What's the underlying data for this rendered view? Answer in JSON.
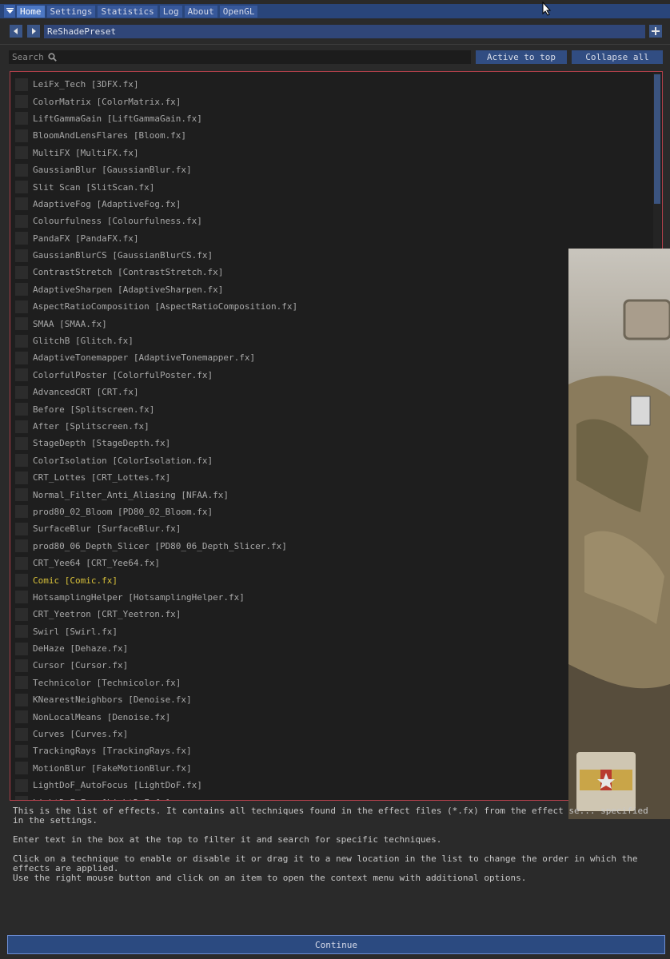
{
  "tabs": [
    "Home",
    "Settings",
    "Statistics",
    "Log",
    "About",
    "OpenGL"
  ],
  "preset": {
    "name": "ReShadePreset",
    "prev_icon": "triangle-left-icon",
    "next_icon": "triangle-right-icon",
    "add_icon": "plus-icon"
  },
  "search": {
    "placeholder": "Search"
  },
  "buttons": {
    "active_to_top": "Active to top",
    "collapse_all": "Collapse all",
    "continue": "Continue"
  },
  "effects": [
    {
      "label": "LeiFx_Tech [3DFX.fx]",
      "enabled": false
    },
    {
      "label": "ColorMatrix [ColorMatrix.fx]",
      "enabled": false
    },
    {
      "label": "LiftGammaGain [LiftGammaGain.fx]",
      "enabled": false
    },
    {
      "label": "BloomAndLensFlares [Bloom.fx]",
      "enabled": false
    },
    {
      "label": "MultiFX [MultiFX.fx]",
      "enabled": false
    },
    {
      "label": "GaussianBlur [GaussianBlur.fx]",
      "enabled": false
    },
    {
      "label": "Slit Scan [SlitScan.fx]",
      "enabled": false
    },
    {
      "label": "AdaptiveFog [AdaptiveFog.fx]",
      "enabled": false
    },
    {
      "label": "Colourfulness [Colourfulness.fx]",
      "enabled": false
    },
    {
      "label": "PandaFX [PandaFX.fx]",
      "enabled": false
    },
    {
      "label": "GaussianBlurCS [GaussianBlurCS.fx]",
      "enabled": false
    },
    {
      "label": "ContrastStretch [ContrastStretch.fx]",
      "enabled": false
    },
    {
      "label": "AdaptiveSharpen [AdaptiveSharpen.fx]",
      "enabled": false
    },
    {
      "label": "AspectRatioComposition [AspectRatioComposition.fx]",
      "enabled": false
    },
    {
      "label": "SMAA [SMAA.fx]",
      "enabled": false
    },
    {
      "label": "GlitchB [Glitch.fx]",
      "enabled": false
    },
    {
      "label": "AdaptiveTonemapper [AdaptiveTonemapper.fx]",
      "enabled": false
    },
    {
      "label": "ColorfulPoster [ColorfulPoster.fx]",
      "enabled": false
    },
    {
      "label": "AdvancedCRT [CRT.fx]",
      "enabled": false
    },
    {
      "label": "Before [Splitscreen.fx]",
      "enabled": false
    },
    {
      "label": "After [Splitscreen.fx]",
      "enabled": false
    },
    {
      "label": "StageDepth [StageDepth.fx]",
      "enabled": false
    },
    {
      "label": "ColorIsolation [ColorIsolation.fx]",
      "enabled": false
    },
    {
      "label": "CRT_Lottes [CRT_Lottes.fx]",
      "enabled": false
    },
    {
      "label": "Normal_Filter_Anti_Aliasing [NFAA.fx]",
      "enabled": false
    },
    {
      "label": "prod80_02_Bloom [PD80_02_Bloom.fx]",
      "enabled": false
    },
    {
      "label": "SurfaceBlur [SurfaceBlur.fx]",
      "enabled": false
    },
    {
      "label": "prod80_06_Depth_Slicer [PD80_06_Depth_Slicer.fx]",
      "enabled": false
    },
    {
      "label": "CRT_Yee64 [CRT_Yee64.fx]",
      "enabled": false
    },
    {
      "label": "Comic [Comic.fx]",
      "enabled": true
    },
    {
      "label": "HotsamplingHelper [HotsamplingHelper.fx]",
      "enabled": false
    },
    {
      "label": "CRT_Yeetron [CRT_Yeetron.fx]",
      "enabled": false
    },
    {
      "label": "Swirl [Swirl.fx]",
      "enabled": false
    },
    {
      "label": "DeHaze [Dehaze.fx]",
      "enabled": false
    },
    {
      "label": "Cursor [Cursor.fx]",
      "enabled": false
    },
    {
      "label": "Technicolor [Technicolor.fx]",
      "enabled": false
    },
    {
      "label": "KNearestNeighbors [Denoise.fx]",
      "enabled": false
    },
    {
      "label": "NonLocalMeans [Denoise.fx]",
      "enabled": false
    },
    {
      "label": "Curves [Curves.fx]",
      "enabled": false
    },
    {
      "label": "TrackingRays [TrackingRays.fx]",
      "enabled": false
    },
    {
      "label": "MotionBlur [FakeMotionBlur.fx]",
      "enabled": false
    },
    {
      "label": "LightDoF_AutoFocus [LightDoF.fx]",
      "enabled": false
    },
    {
      "label": "LightDoF_Far [LightDoF.fx]",
      "enabled": false
    }
  ],
  "description": [
    "This is the list of effects. It contains all techniques found in the effect files (*.fx) from the effect se... specified in the settings.",
    "Enter text in the box at the top to filter it and search for specific techniques.",
    "Click on a technique to enable or disable it or drag it to a new location in the list to change the order in which the effects are applied.\nUse the right mouse button and click on an item to open the context menu with additional options."
  ],
  "colors": {
    "accent": "#29457a",
    "active_effect": "#d9c23a",
    "list_border": "#b0404a"
  }
}
